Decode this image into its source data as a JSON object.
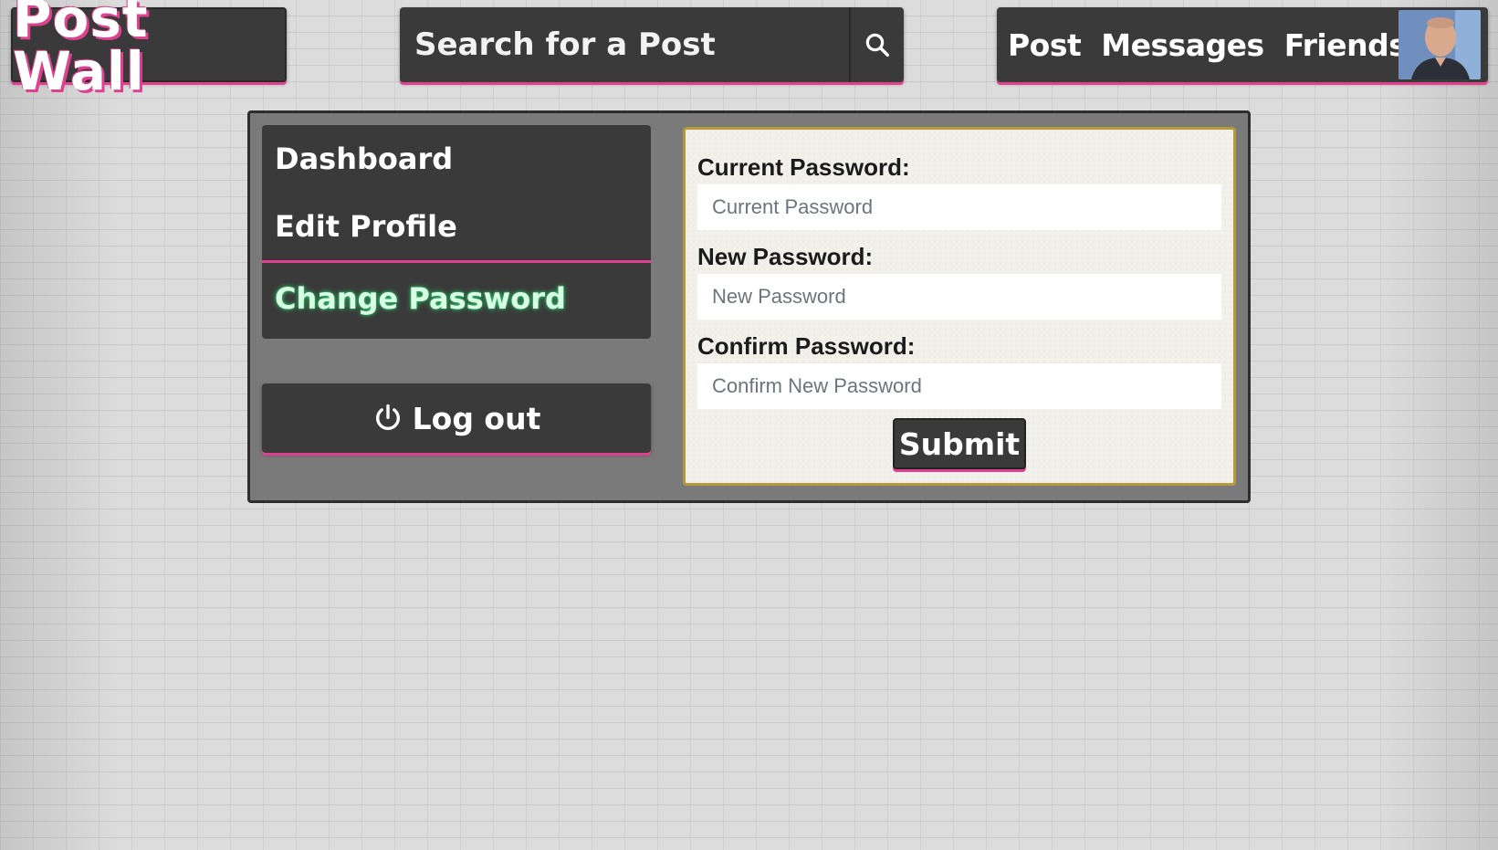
{
  "header": {
    "logo_text": "Post Wall",
    "search": {
      "placeholder": "Search for a Post",
      "icon": "search-icon"
    },
    "nav": {
      "items": [
        {
          "label": "Post"
        },
        {
          "label": "Messages"
        },
        {
          "label": "Friends"
        }
      ],
      "avatar": "avatar"
    }
  },
  "sidebar": {
    "items": [
      {
        "label": "Dashboard"
      },
      {
        "label": "Edit Profile"
      },
      {
        "label": "Change Password",
        "active": true
      }
    ],
    "logout": {
      "label": "Log out",
      "icon": "power-icon"
    }
  },
  "form": {
    "fields": [
      {
        "label": "Current Password:",
        "placeholder": "Current Password"
      },
      {
        "label": "New Password:",
        "placeholder": "New Password"
      },
      {
        "label": "Confirm Password:",
        "placeholder": "Confirm New Password"
      }
    ],
    "submit_label": "Submit"
  },
  "colors": {
    "accent_pink": "#e0418f",
    "active_glow_green": "#2ec26a",
    "dark_box": "#3a3a3a",
    "card_border_gold": "#b59a3c"
  }
}
